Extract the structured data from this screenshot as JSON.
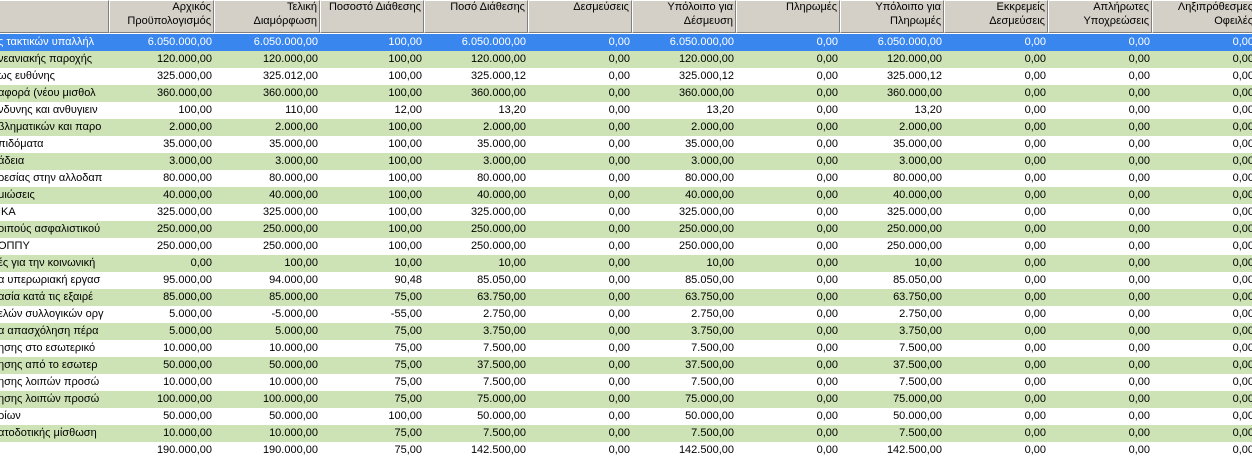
{
  "columns": [
    {
      "key": "name",
      "l1": "",
      "l2": ""
    },
    {
      "key": "c1",
      "l1": "Αρχικός",
      "l2": "Προϋπολογισμός"
    },
    {
      "key": "c2",
      "l1": "Τελική",
      "l2": "Διαμόρφωση"
    },
    {
      "key": "c3",
      "l1": "Ποσοστό Διάθεσης",
      "l2": ""
    },
    {
      "key": "c4",
      "l1": "Ποσό Διάθεσης",
      "l2": ""
    },
    {
      "key": "c5",
      "l1": "Δεσμεύσεις",
      "l2": ""
    },
    {
      "key": "c6",
      "l1": "Υπόλοιπο για",
      "l2": "Δέσμευση"
    },
    {
      "key": "c7",
      "l1": "Πληρωμές",
      "l2": ""
    },
    {
      "key": "c8",
      "l1": "Υπόλοιπο για",
      "l2": "Πληρωμές"
    },
    {
      "key": "c9",
      "l1": "Εκκρεμείς",
      "l2": "Δεσμεύσεις"
    },
    {
      "key": "c10",
      "l1": "Απλήρωτες",
      "l2": "Υποχρεώσεις"
    },
    {
      "key": "c11",
      "l1": "Ληξιπρόθεσμες",
      "l2": "Οφειλές"
    }
  ],
  "rows": [
    [
      "ς τακτικών υπαλλήλ",
      "6.050.000,00",
      "6.050.000,00",
      "100,00",
      "6.050.000,00",
      "0,00",
      "6.050.000,00",
      "0,00",
      "6.050.000,00",
      "0,00",
      "0,00",
      "0,00"
    ],
    [
      "νεανιακής παροχής",
      "120.000,00",
      "120.000,00",
      "100,00",
      "120.000,00",
      "0,00",
      "120.000,00",
      "0,00",
      "120.000,00",
      "0,00",
      "0,00",
      "0,00"
    ],
    [
      "ως ευθύνης",
      "325.000,00",
      "325.012,00",
      "100,00",
      "325.000,12",
      "0,00",
      "325.000,12",
      "0,00",
      "325.000,12",
      "0,00",
      "0,00",
      "0,00"
    ],
    [
      "αφορά (νέου μισθολ",
      "360.000,00",
      "360.000,00",
      "100,00",
      "360.000,00",
      "0,00",
      "360.000,00",
      "0,00",
      "360.000,00",
      "0,00",
      "0,00",
      "0,00"
    ],
    [
      "νδυνης και ανθυγιειν",
      "100,00",
      "110,00",
      "12,00",
      "13,20",
      "0,00",
      "13,20",
      "0,00",
      "13,20",
      "0,00",
      "0,00",
      "0,00"
    ],
    [
      "βληματικών και παρο",
      "2.000,00",
      "2.000,00",
      "100,00",
      "2.000,00",
      "0,00",
      "2.000,00",
      "0,00",
      "2.000,00",
      "0,00",
      "0,00",
      "0,00"
    ],
    [
      "πιδόματα",
      "35.000,00",
      "35.000,00",
      "100,00",
      "35.000,00",
      "0,00",
      "35.000,00",
      "0,00",
      "35.000,00",
      "0,00",
      "0,00",
      "0,00"
    ],
    [
      "άδεια",
      "3.000,00",
      "3.000,00",
      "100,00",
      "3.000,00",
      "0,00",
      "3.000,00",
      "0,00",
      "3.000,00",
      "0,00",
      "0,00",
      "0,00"
    ],
    [
      "ρεσίας στην αλλοδαπ",
      "80.000,00",
      "80.000,00",
      "100,00",
      "80.000,00",
      "0,00",
      "80.000,00",
      "0,00",
      "80.000,00",
      "0,00",
      "0,00",
      "0,00"
    ],
    [
      "μιώσεις",
      "40.000,00",
      "40.000,00",
      "100,00",
      "40.000,00",
      "0,00",
      "40.000,00",
      "0,00",
      "40.000,00",
      "0,00",
      "0,00",
      "0,00"
    ],
    [
      "ΙΚΑ",
      "325.000,00",
      "325.000,00",
      "100,00",
      "325.000,00",
      "0,00",
      "325.000,00",
      "0,00",
      "325.000,00",
      "0,00",
      "0,00",
      "0,00"
    ],
    [
      "οιπούς ασφαλιστικού",
      "250.000,00",
      "250.000,00",
      "100,00",
      "250.000,00",
      "0,00",
      "250.000,00",
      "0,00",
      "250.000,00",
      "0,00",
      "0,00",
      "0,00"
    ],
    [
      "ΟΠΠΥ",
      "250.000,00",
      "250.000,00",
      "100,00",
      "250.000,00",
      "0,00",
      "250.000,00",
      "0,00",
      "250.000,00",
      "0,00",
      "0,00",
      "0,00"
    ],
    [
      "ές για την κοινωνική",
      "0,00",
      "100,00",
      "10,00",
      "10,00",
      "0,00",
      "10,00",
      "0,00",
      "10,00",
      "0,00",
      "0,00",
      "0,00"
    ],
    [
      "α υπερωριακή εργασ",
      "95.000,00",
      "94.000,00",
      "90,48",
      "85.050,00",
      "0,00",
      "85.050,00",
      "0,00",
      "85.050,00",
      "0,00",
      "0,00",
      "0,00"
    ],
    [
      "ασία κατά τις εξαιρέ",
      "85.000,00",
      "85.000,00",
      "75,00",
      "63.750,00",
      "0,00",
      "63.750,00",
      "0,00",
      "63.750,00",
      "0,00",
      "0,00",
      "0,00"
    ],
    [
      "ελών συλλογικών οργ",
      "5.000,00",
      "-5.000,00",
      "-55,00",
      "2.750,00",
      "0,00",
      "2.750,00",
      "0,00",
      "2.750,00",
      "0,00",
      "0,00",
      "0,00"
    ],
    [
      "α απασχόληση πέρα",
      "5.000,00",
      "5.000,00",
      "75,00",
      "3.750,00",
      "0,00",
      "3.750,00",
      "0,00",
      "3.750,00",
      "0,00",
      "0,00",
      "0,00"
    ],
    [
      "ησης στο εσωτερικό",
      "10.000,00",
      "10.000,00",
      "75,00",
      "7.500,00",
      "0,00",
      "7.500,00",
      "0,00",
      "7.500,00",
      "0,00",
      "0,00",
      "0,00"
    ],
    [
      "ησης από το εσωτερ",
      "50.000,00",
      "50.000,00",
      "75,00",
      "37.500,00",
      "0,00",
      "37.500,00",
      "0,00",
      "37.500,00",
      "0,00",
      "0,00",
      "0,00"
    ],
    [
      "ησης λοιπών προσώ",
      "10.000,00",
      "10.000,00",
      "75,00",
      "7.500,00",
      "0,00",
      "7.500,00",
      "0,00",
      "7.500,00",
      "0,00",
      "0,00",
      "0,00"
    ],
    [
      "ησης λοιπών προσώ",
      "100.000,00",
      "100.000,00",
      "75,00",
      "75.000,00",
      "0,00",
      "75.000,00",
      "0,00",
      "75.000,00",
      "0,00",
      "0,00",
      "0,00"
    ],
    [
      "ρίων",
      "50.000,00",
      "50.000,00",
      "100,00",
      "50.000,00",
      "0,00",
      "50.000,00",
      "0,00",
      "50.000,00",
      "0,00",
      "0,00",
      "0,00"
    ],
    [
      "ατοδοτικής μίσθωση",
      "10.000,00",
      "10.000,00",
      "75,00",
      "7.500,00",
      "0,00",
      "7.500,00",
      "0,00",
      "7.500,00",
      "0,00",
      "0,00",
      "0,00"
    ],
    [
      "",
      "190.000,00",
      "190.000,00",
      "75,00",
      "142.500,00",
      "0,00",
      "142.500,00",
      "0,00",
      "142.500,00",
      "0,00",
      "0,00",
      "0,00"
    ]
  ],
  "selected_row": 0
}
